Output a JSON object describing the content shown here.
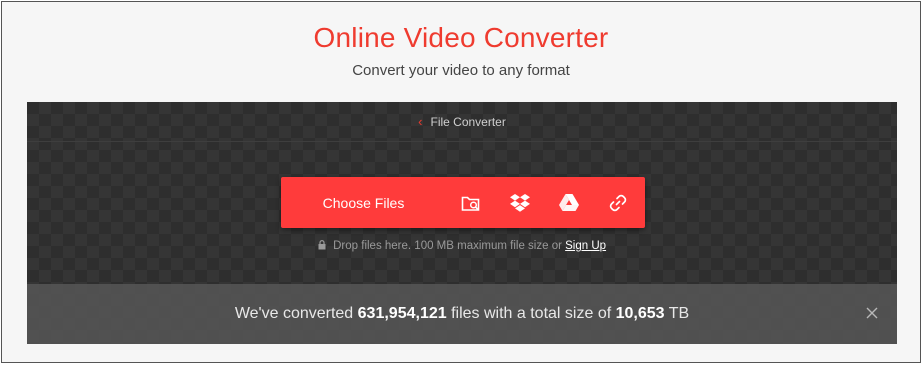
{
  "hero": {
    "title": "Online Video Converter",
    "subtitle": "Convert your video to any format"
  },
  "breadcrumb": {
    "back_icon": "chevron-left-icon",
    "label": "File Converter"
  },
  "upload": {
    "choose_label": "Choose Files",
    "sources": [
      {
        "name": "from-device-icon"
      },
      {
        "name": "dropbox-icon"
      },
      {
        "name": "google-drive-icon"
      },
      {
        "name": "url-link-icon"
      }
    ],
    "accent_color": "#ff3b3b"
  },
  "hint": {
    "text": "Drop files here. 100 MB maximum file size or",
    "signup_label": "Sign Up"
  },
  "stats": {
    "prefix": "We've converted",
    "files_count": "631,954,121",
    "middle": "files with a total size of",
    "total_size": "10,653",
    "unit": "TB"
  },
  "colors": {
    "brand_red": "#ef3b2f",
    "panel_dark": "#2e2e2e"
  }
}
